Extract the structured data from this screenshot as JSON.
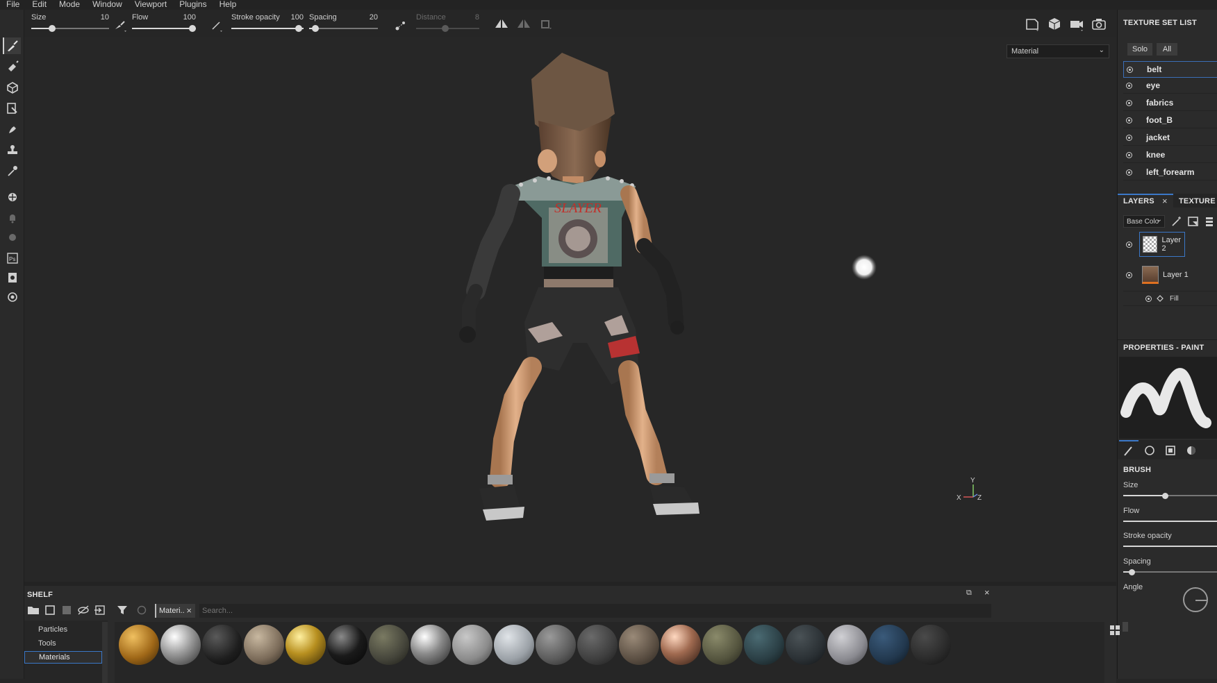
{
  "menu": [
    "File",
    "Edit",
    "Mode",
    "Window",
    "Viewport",
    "Plugins",
    "Help"
  ],
  "toolbar": {
    "size_label": "Size",
    "size_value": "10",
    "flow_label": "Flow",
    "flow_value": "100",
    "stroke_opacity_label": "Stroke opacity",
    "stroke_opacity_value": "100",
    "spacing_label": "Spacing",
    "spacing_value": "20",
    "distance_label": "Distance",
    "distance_value": "8"
  },
  "viewport": {
    "display_mode": "Material",
    "axis_y": "Y",
    "axis_x": "X",
    "axis_z": "Z",
    "shirt_text": "SLAYER"
  },
  "texture_set_list": {
    "title": "TEXTURE SET LIST",
    "solo_label": "Solo",
    "all_label": "All",
    "items": [
      "belt",
      "eye",
      "fabrics",
      "foot_B",
      "jacket",
      "knee",
      "left_forearm"
    ]
  },
  "layers": {
    "tab_layers": "LAYERS",
    "tab_texture": "TEXTURE S",
    "channel": "Base Colo",
    "items": [
      "Layer 2",
      "Layer 1"
    ],
    "fill_label": "Fill"
  },
  "properties": {
    "title": "PROPERTIES - PAINT",
    "brush_header": "BRUSH",
    "size_label": "Size",
    "flow_label": "Flow",
    "stroke_opacity_label": "Stroke opacity",
    "spacing_label": "Spacing",
    "angle_label": "Angle"
  },
  "shelf": {
    "title": "SHELF",
    "tab_label": "Materi..",
    "search_placeholder": "Search...",
    "categories": [
      "Particles",
      "Tools",
      "Materials"
    ],
    "selected_category": "Materials"
  },
  "colors": {
    "accent": "#3b78c8",
    "panel": "#2b2b2b",
    "viewport": "#272727"
  }
}
